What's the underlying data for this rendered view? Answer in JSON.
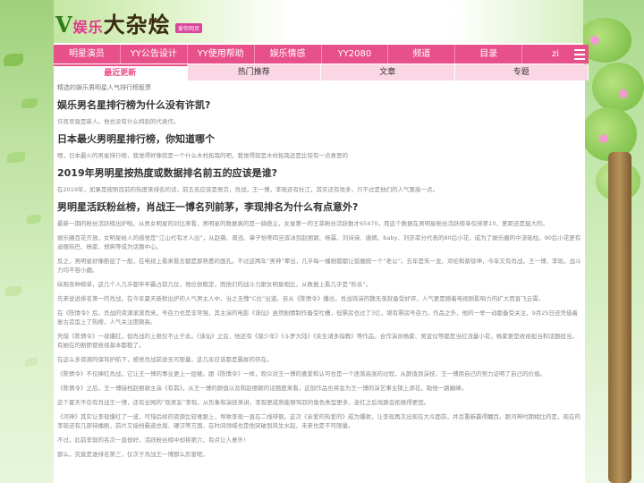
{
  "logo": {
    "text_v": "V",
    "text_main": "大杂烩",
    "text_pink": "娱乐",
    "tagline": "爱你网页"
  },
  "nav": {
    "items": [
      "明星演员",
      "YY公告设计",
      "YY使用帮助",
      "娱乐情感",
      "YY2080",
      "频道",
      "目录",
      "zi"
    ],
    "menu_icon": "hamburger-icon"
  },
  "tabs": [
    {
      "label": "最近更新",
      "active": true
    },
    {
      "label": "热门推荐",
      "active": false
    },
    {
      "label": "文章",
      "active": false
    },
    {
      "label": "专题",
      "active": false
    }
  ],
  "breadcrumb": "精选的娱乐男明星人气排行榜股票",
  "sections": [
    {
      "title": "娱乐男名星排行榜为什么没有许凯?",
      "paragraphs": [
        "许凯早竟是新人。他也没有什么特别的代表作。"
      ]
    },
    {
      "title": "日本最火男明星排行榜，你知道哪个",
      "paragraphs": [
        "嗯，日本最火的男星排行榜，我觉得好像就是一个什么木村拓哉的吧，我觉得就是木村拓哉还是比较有一点意思的"
      ]
    },
    {
      "title": "2019年男明星按热度或数据排名前五的应该是谁?",
      "paragraphs": [
        "在2019年，如果是按照目前的热度来排名的话，前五名应该是吴京，肖战，王一博，李现还有杜江，其实还有很多，只不过是他们的人气要高一点。"
      ]
    },
    {
      "title": "男明星活跃粉丝榜，肖战王一博名列前茅，李现排名为什么有点意外?",
      "paragraphs": [
        "最新一期的粉丝活跃榜出炉啦，从男女明星的对比来看，男明星的数据真的是一骑绝尘，女星第一的王菲粉丝活跃数才65470，而这个数据在男明星粉丝活跃榜单仅排第10，差距还是挺大的。",
        "娱乐圈百花齐放，女明星给人的感觉是“江山代有才人出”，从赵薇、周迅、章子怡等四旦双冰到赵丽颖、杨幂、刘诗诗、唐嫣、baby、刘亦菲分代表的80后小花，成为了娱乐圈的中流砥柱。90后小花更有迪丽热巴、杨紫、郑爽等成为话题中心。",
        "反之，男明星好像断层了一般，在电视上看来看去都是那熟悉的面孔。不过这两年“男神”辈出，几乎每一播剧都都让饭圈掀一个“老公”。去年是朱一龙、邓伦和蔡徐坤，今年又有肖战，王一博、李现，战斗力均不容小觑。",
        "纵观各种榜单，这几个人几乎都牢牢霸占前几位，地位很稳定，而他们的战斗力跟女明星相比，从数据上看几乎是“秒杀”。",
        "先来说说排名第一的肖战，在今年夏天新鲜出炉的人气男主人中，当之无愧“C位”出道。自从《陈情令》播出，肖战饰演的魏无羡就备受好评，人气更是随着电视剧影响力的扩大而直飞云霄。",
        "在《陈情令》后，肖战的资源滚滚而来，号召力也是非常强，其主演的电影《诛仙》虽然剧情制作备受吐槽，但票房也过了3亿，堪有票房号召力。作品之外，他的一举一动都备受关注，9月25日还凭借着复古造型上了热搜，人气关注度颇高。",
        "凭借《陈情令》一夜爆红，但肖战的上限仅不止于此。《诛仙》之后，他还有《狼少年》《斗罗大陆》《余生请多指教》等作品，合作演员杨紫、吴宣仪等都是当红流量小花，杨紫更是收视担当和话题担当，有她在的剧即使收视基本都稳了。",
        "在这么多资源的保驾护航下，感觉肖战前途无可限量，这几年应该都是霸屏的存在。",
        "《陈情令》不仅捧红肖战，它让王一博的事业更上一层楼。跟《陈情令》一样，观众对王一博的喜爱和认可也是一个逐渐高涨的过程，从颜值到演技，王一博用自己的努力证明了自己的价值。",
        "《陈情令》之后，王一博接档赵丽颖主演《有翡》，从王一博的颜值以及和赵丽颖的话题度来看，这部作品也将会为王一博的演艺事业锦上添花，助他一路巅峰。",
        "这个夏天不仅有肖战王一博，还有全网的“现男友”李现，从形象和演技来讲，李现更成熟能够驾驭的角色类型更多，走红之后戏路会拓展得更宽。",
        "《河神》其实让李现爆红了一波，可惜后续的资源比较难跟上，导致李现一直在二线徘徊。这次《亲爱的热爱的》成为爆款，让李现再次出现在大众面前，并且重新赢得瞩目。跟河神时期相比的是，现在的李现还有几部待播剧，前片又接档霸道总裁、硬汉等方面，在时间领域也是他突破到风生水起，未来也是不可限量。",
        "不过，此前李现的名次一直很好，活跃粉丝榜中却排第六，有点让人意外!",
        "那么，究竟是谁排名第三，仅次于肖战王一博那么厉害呢。"
      ]
    }
  ]
}
